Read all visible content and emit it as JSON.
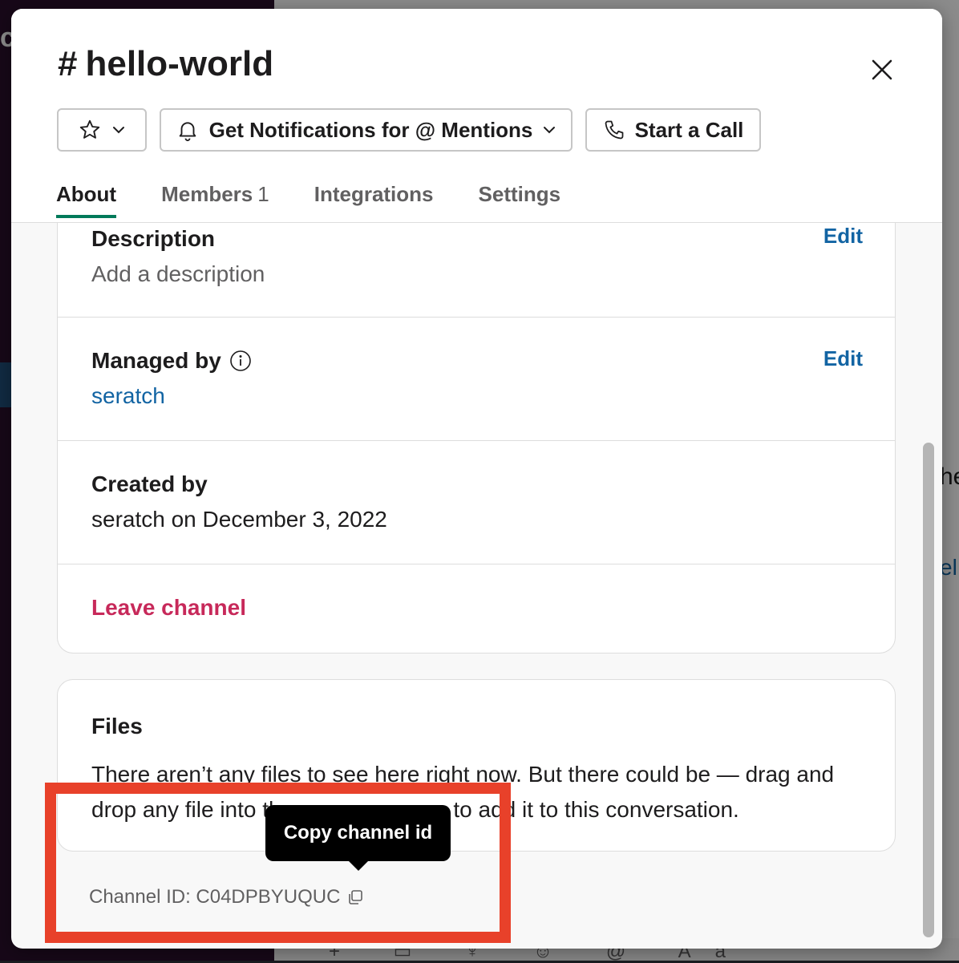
{
  "background": {
    "top_letter": "c",
    "right_text_1": "he",
    "right_text_2": "el",
    "composer_icons": "+ ▭ ♆ ☺ @ Aa"
  },
  "modal": {
    "title_hash": "#",
    "title": "hello-world",
    "close_icon": "close-icon"
  },
  "toolbar": {
    "star_icon": "star-icon",
    "notifications_label": "Get Notifications for @ Mentions",
    "call_label": "Start a Call"
  },
  "tabs": [
    {
      "label": "About",
      "active": true
    },
    {
      "label": "Members",
      "count": "1"
    },
    {
      "label": "Integrations"
    },
    {
      "label": "Settings"
    }
  ],
  "about": {
    "description_label": "Description",
    "description_value": "Add a description",
    "edit_label": "Edit",
    "managed_label": "Managed by",
    "managed_value": "seratch",
    "created_label": "Created by",
    "created_value": "seratch on December 3, 2022",
    "leave_label": "Leave channel"
  },
  "files": {
    "title": "Files",
    "text": "There aren’t any files to see here right now. But there could be — drag and drop any file into the message pane to add it to this conversation."
  },
  "footer": {
    "channel_id_label": "Channel ID: C04DPBYUQUC",
    "tooltip": "Copy channel id"
  },
  "colors": {
    "accent_tab": "#007a5a",
    "link": "#1264a3",
    "danger": "#c7295a",
    "highlight": "#e8412a"
  }
}
